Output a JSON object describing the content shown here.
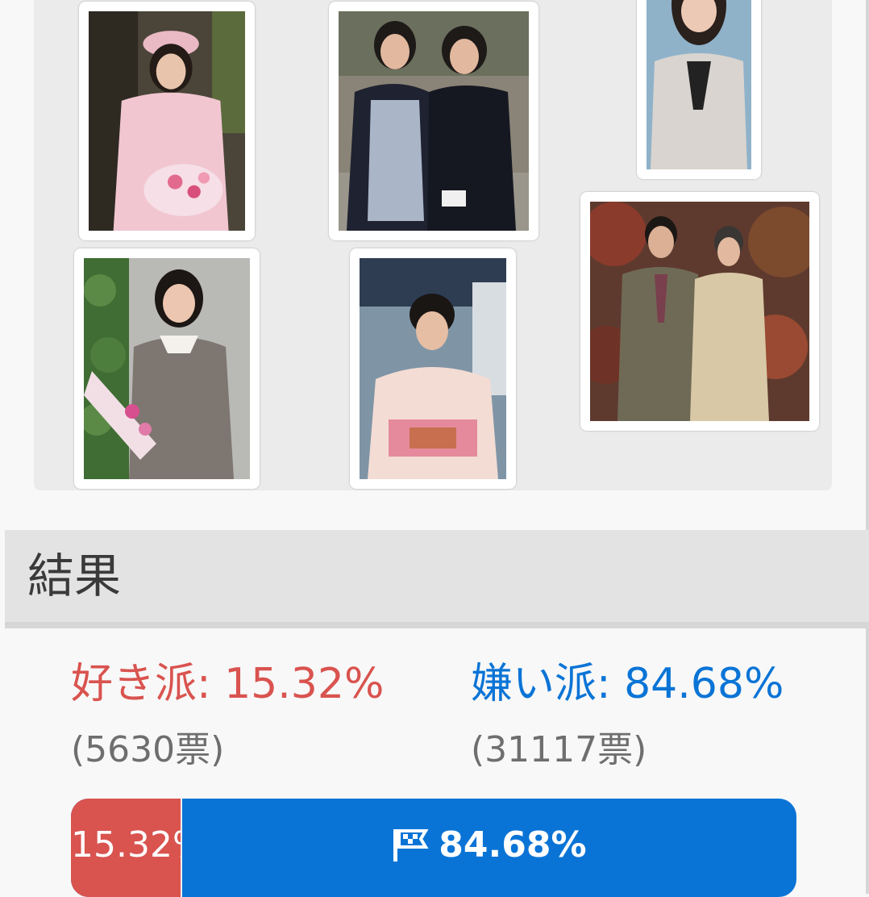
{
  "gallery": {
    "photos": [
      {
        "name": "photo-pink-dress-bouquet"
      },
      {
        "name": "photo-two-girls-school"
      },
      {
        "name": "photo-beige-jacket"
      },
      {
        "name": "photo-floral-dress-bouquet"
      },
      {
        "name": "photo-kimono"
      },
      {
        "name": "photo-couple-autumn"
      }
    ]
  },
  "results": {
    "title": "結果",
    "like": {
      "label": "好き派",
      "percent": "15.32%",
      "votes": "(5630票)",
      "fraction": 0.1532
    },
    "dislike": {
      "label": "嫌い派",
      "percent": "84.68%",
      "votes": "(31117票)",
      "fraction": 0.8468
    },
    "separator": ": "
  },
  "colors": {
    "like": "#d9534f",
    "dislike": "#0a74d6"
  },
  "icons": {
    "bar": "flag-icon"
  }
}
